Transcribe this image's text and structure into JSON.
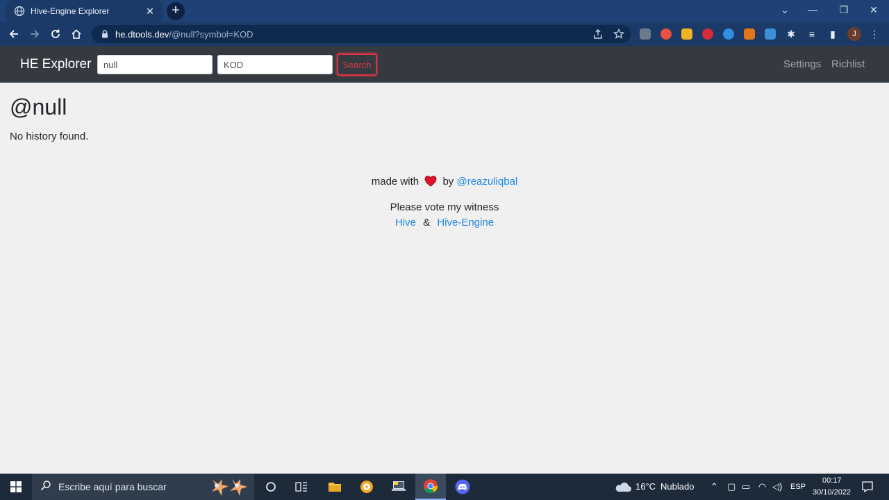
{
  "browser": {
    "tab_title": "Hive-Engine Explorer",
    "tab_close_glyph": "✕",
    "new_tab_glyph": "+",
    "url_host": "he.dtools.dev",
    "url_path": "/@null?symbol=KOD",
    "profile_initial": "J",
    "window_controls": {
      "collapse": "⌄",
      "minimize": "—",
      "restore": "❐",
      "close": "✕"
    },
    "icons": [
      "back-icon",
      "forward-icon",
      "reload-icon",
      "home-icon",
      "lock-icon",
      "share-icon",
      "star-icon",
      "extensions-icon",
      "reading-list-icon",
      "side-panel-icon",
      "menu-icon"
    ]
  },
  "navbar": {
    "brand": "HE Explorer",
    "account_value": "null",
    "symbol_value": "KOD",
    "search_label": "Search",
    "links": [
      "Settings",
      "Richlist"
    ]
  },
  "content": {
    "title": "@null",
    "empty_message": "No history found."
  },
  "footer": {
    "made_with": "made with",
    "by": "by",
    "author": "@reazuliqbal",
    "vote_text": "Please vote my witness",
    "hive_link": "Hive",
    "amp": "&",
    "he_link": "Hive-Engine"
  },
  "taskbar": {
    "search_placeholder": "Escribe aquí para buscar",
    "temperature": "16°C",
    "weather": "Nublado",
    "language": "ESP",
    "time": "00:17",
    "date": "30/10/2022"
  },
  "colors": {
    "navbar_bg": "#343a40",
    "link": "#1e88e5",
    "danger": "#dc3545",
    "heart": "#e3122a",
    "chrome_bg": "#1b3a68"
  }
}
